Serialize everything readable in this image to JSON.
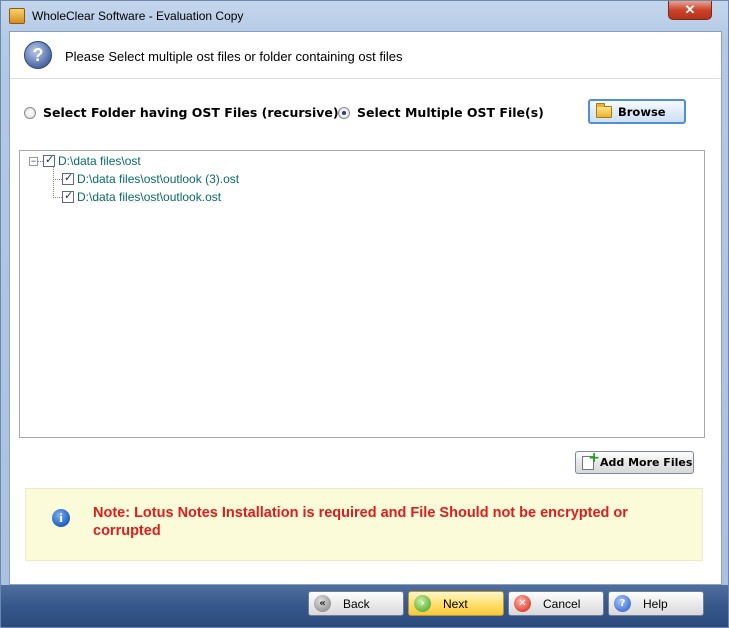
{
  "window": {
    "title": "WholeClear Software - Evaluation Copy",
    "close_glyph": "✕"
  },
  "header": {
    "icon": "help-icon",
    "icon_glyph": "?",
    "text": "Please Select multiple ost files or folder containing ost files"
  },
  "options": {
    "folder_option": {
      "label": "Select Folder having OST Files (recursive)",
      "selected": false
    },
    "files_option": {
      "label": "Select Multiple OST File(s)",
      "selected": true
    },
    "browse_label": "Browse"
  },
  "tree": {
    "root": {
      "expander": "−",
      "label": "D:\\data files\\ost",
      "checked": true
    },
    "children": [
      {
        "label": "D:\\data files\\ost\\outlook (3).ost",
        "checked": true
      },
      {
        "label": "D:\\data files\\ost\\outlook.ost",
        "checked": true
      }
    ]
  },
  "add_more_label": "Add More Files",
  "note": {
    "icon": "info-icon",
    "icon_glyph": "i",
    "text": "Note: Lotus Notes Installation is required and File Should not be encrypted or corrupted"
  },
  "footer": {
    "back": {
      "label": "Back",
      "glyph": "«"
    },
    "next": {
      "label": "Next",
      "glyph": "›"
    },
    "cancel": {
      "label": "Cancel",
      "glyph": "✕"
    },
    "help": {
      "label": "Help",
      "glyph": "?"
    }
  },
  "colors": {
    "note_text": "#e21b1b",
    "tree_text": "#0a6a6a",
    "bottom_bar": "#36578a"
  }
}
